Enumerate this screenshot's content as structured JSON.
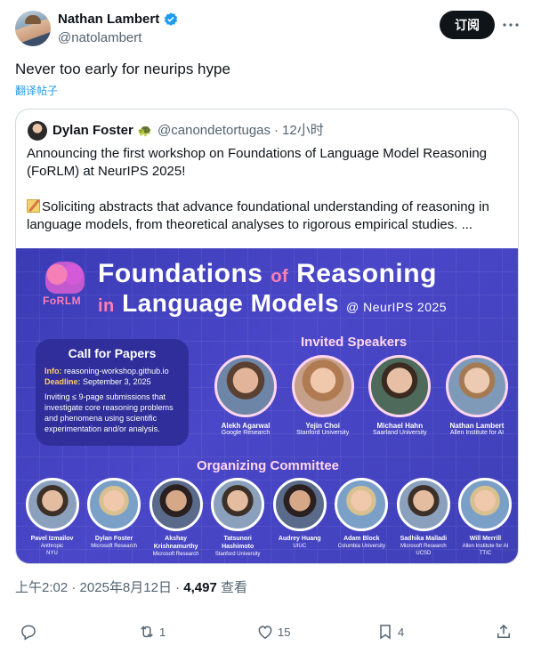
{
  "author": {
    "name": "Nathan Lambert",
    "handle": "@natolambert",
    "verified": true
  },
  "subscribe_label": "订阅",
  "post_text": "Never too early for neurips hype",
  "translate_label": "翻译帖子",
  "quote": {
    "name": "Dylan Foster",
    "emoji": "turtle",
    "handle": "@canondetortugas",
    "time": "12小时",
    "para1": "Announcing the first workshop on Foundations of Language Model Reasoning (FoRLM) at NeurIPS 2025!",
    "para2": "Soliciting abstracts that advance foundational understanding of reasoning in language models, from theoretical analyses to rigorous empirical studies. ..."
  },
  "banner": {
    "logo_label": "FoRLM",
    "title_line1_a": "Foundations",
    "title_line1_of": "of",
    "title_line1_b": "Reasoning",
    "title_line2_in": "in",
    "title_line2_b": "Language Models",
    "title_at": "@ NeurIPS 2025",
    "cfp_title": "Call for Papers",
    "cfp_info_key": "Info:",
    "cfp_info_val": "reasoning-workshop.github.io",
    "cfp_deadline_key": "Deadline:",
    "cfp_deadline_val": "September 3, 2025",
    "cfp_body": "Inviting ≤ 9-page submissions that investigate core reasoning problems and phenomena using scientific experimentation and/or analysis.",
    "invited_title": "Invited Speakers",
    "invited": [
      {
        "name": "Alekh Agarwal",
        "aff": "Google Research"
      },
      {
        "name": "Yejin Choi",
        "aff": "Stanford University"
      },
      {
        "name": "Michael Hahn",
        "aff": "Saarland University"
      },
      {
        "name": "Nathan Lambert",
        "aff": "Allen Institute for AI"
      }
    ],
    "org_title": "Organizing Committee",
    "organizers": [
      {
        "name": "Pavel Izmailov",
        "aff": "Anthropic\nNYU"
      },
      {
        "name": "Dylan Foster",
        "aff": "Microsoft Research"
      },
      {
        "name": "Akshay Krishnamurthy",
        "aff": "Microsoft Research"
      },
      {
        "name": "Tatsunori Hashimoto",
        "aff": "Stanford University"
      },
      {
        "name": "Audrey Huang",
        "aff": "UIUC"
      },
      {
        "name": "Adam Block",
        "aff": "Columbia University"
      },
      {
        "name": "Sadhika Malladi",
        "aff": "Microsoft Research\nUCSD"
      },
      {
        "name": "Will Merrill",
        "aff": "Allen Institute for AI\nTTIC"
      }
    ]
  },
  "meta": {
    "time": "上午2:02",
    "date": "2025年8月12日",
    "views": "4,497",
    "views_label": "查看"
  },
  "actions": {
    "replies": "",
    "reposts": "1",
    "likes": "15",
    "bookmarks": "4"
  }
}
